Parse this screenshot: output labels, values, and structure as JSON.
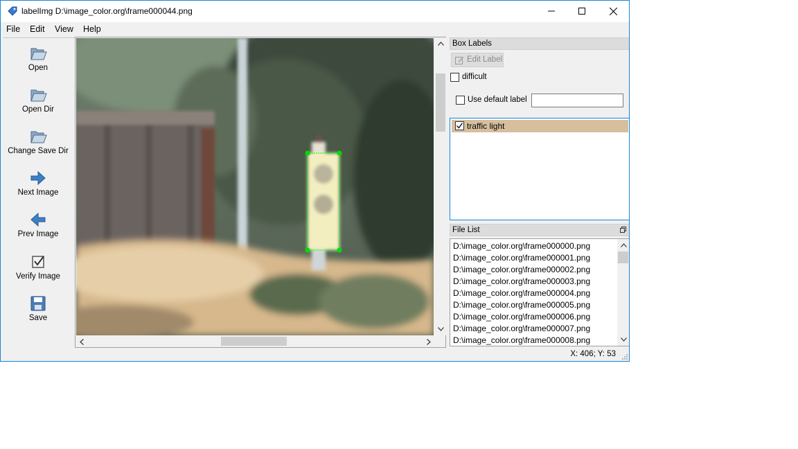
{
  "window": {
    "title": "labelImg D:\\image_color.org\\frame000044.png",
    "accent_color": "#1883d7"
  },
  "menu": {
    "file": "File",
    "edit": "Edit",
    "view": "View",
    "help": "Help"
  },
  "toolbar": {
    "open": "Open",
    "open_dir": "Open Dir",
    "change_save_dir": "Change Save Dir",
    "next_image": "Next Image",
    "prev_image": "Prev Image",
    "verify_image": "Verify Image",
    "save": "Save"
  },
  "box_labels": {
    "title": "Box Labels",
    "edit_label": "Edit Label",
    "difficult": "difficult",
    "use_default_label": "Use default label",
    "default_label_value": "",
    "items": [
      {
        "label": "traffic light",
        "checked": true,
        "color": "#d7bf9e"
      }
    ]
  },
  "file_list": {
    "title": "File List",
    "files": [
      "D:\\image_color.org\\frame000000.png",
      "D:\\image_color.org\\frame000001.png",
      "D:\\image_color.org\\frame000002.png",
      "D:\\image_color.org\\frame000003.png",
      "D:\\image_color.org\\frame000004.png",
      "D:\\image_color.org\\frame000005.png",
      "D:\\image_color.org\\frame000006.png",
      "D:\\image_color.org\\frame000007.png",
      "D:\\image_color.org\\frame000008.png"
    ]
  },
  "status": {
    "coords": "X: 406; Y: 53"
  }
}
